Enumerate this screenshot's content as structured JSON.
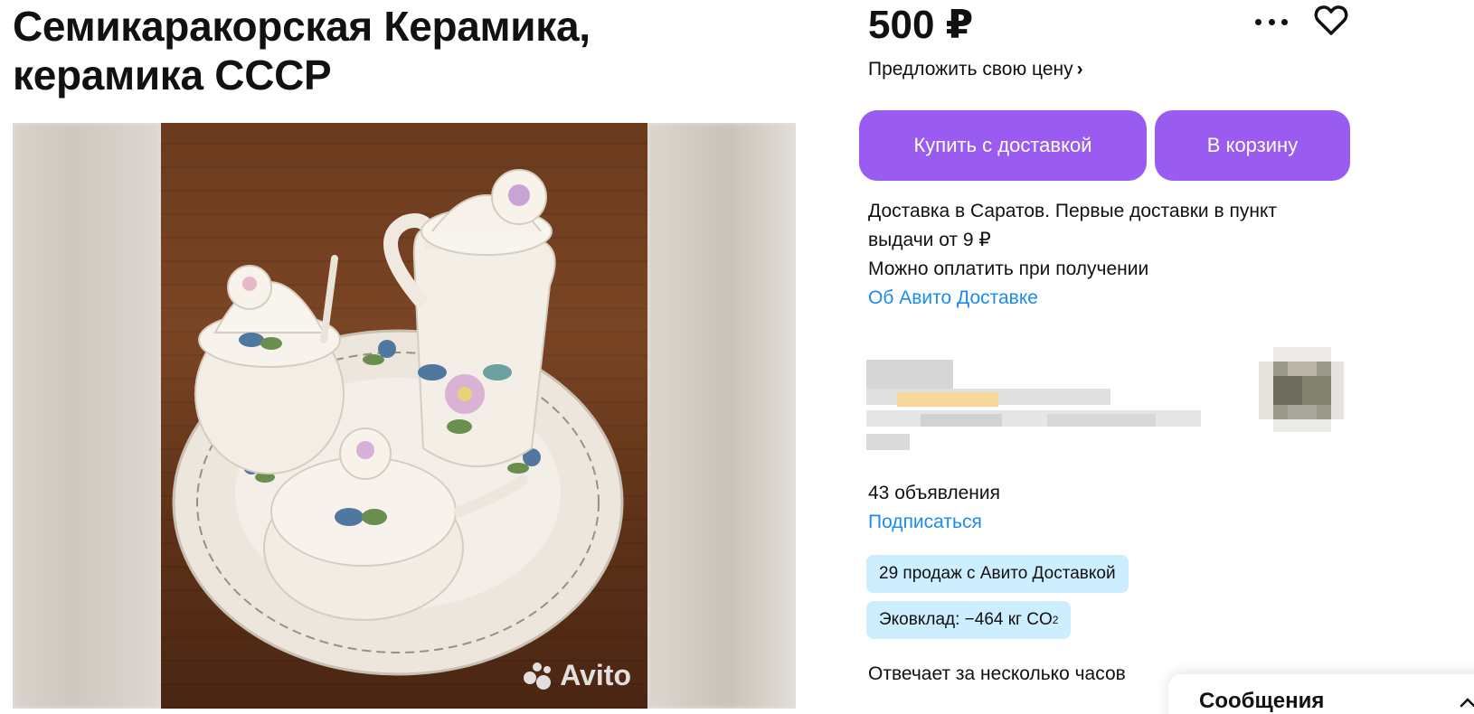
{
  "listing": {
    "title_line1": "Семикаракорская Керамика,",
    "title_line2": "керамика СССР",
    "price": "500 ₽",
    "offer_price_label": "Предложить свою цену",
    "offer_chevron": "›"
  },
  "actions": {
    "buy_delivery_label": "Купить с доставкой",
    "add_to_cart_label": "В корзину",
    "more_icon": "more-dots-icon",
    "favorite_icon": "heart-icon"
  },
  "delivery": {
    "line1": "Доставка в Саратов. Первые доставки в пункт",
    "line2": "выдачи от 9 ₽",
    "payment": "Можно оплатить при получении",
    "about_link": "Об Авито Доставке"
  },
  "seller": {
    "ads_count": "43 объявления",
    "subscribe_label": "Подписаться",
    "sales_badge": "29 продаж с Авито Доставкой",
    "eco_badge_prefix": "Эковклад: −464 кг CO",
    "eco_badge_sub": "2",
    "response_time": "Отвечает за несколько часов"
  },
  "gallery": {
    "watermark": "Avito"
  },
  "messages_panel": {
    "label": "Сообщения"
  },
  "colors": {
    "accent": "#9a5bf0",
    "link": "#1a8cf0",
    "badge_bg": "#cdeeff"
  }
}
